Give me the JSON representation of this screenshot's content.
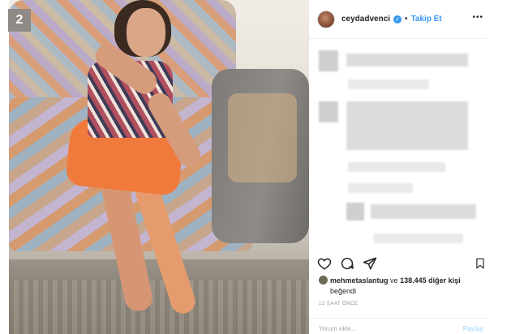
{
  "badge": {
    "number": "2"
  },
  "post": {
    "username": "ceydadvenci",
    "separator": "•",
    "follow_label": "Takip Et",
    "more_label": "•••",
    "likes": {
      "user": "mehmetaslantug",
      "connector": "ve",
      "count_text": "138.445 diğer kişi",
      "suffix": "beğendi"
    },
    "timestamp": "12 SAAT ÖNCE",
    "comment_placeholder": "Yorum ekle...",
    "post_button": "Paylaş"
  },
  "icons": {
    "verified": "verified-check-icon",
    "like": "heart-icon",
    "comment": "comment-bubble-icon",
    "share": "paper-plane-icon",
    "save": "bookmark-icon"
  },
  "colors": {
    "accent": "#3897f0",
    "text": "#262626",
    "muted": "#8e8e8e",
    "badge_bg": "#8e8a86",
    "skirt": "#f07a3c"
  }
}
